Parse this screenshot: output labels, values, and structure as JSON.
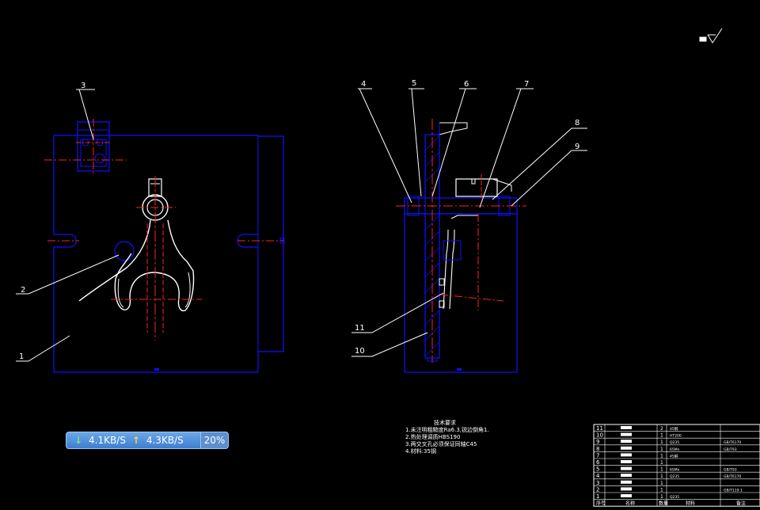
{
  "drawing": {
    "balloons": [
      "1",
      "2",
      "3",
      "4",
      "5",
      "6",
      "7",
      "8",
      "9",
      "10",
      "11"
    ],
    "tech_title": "技术要求",
    "tech_notes": [
      "1.未注明粗糙度Ra6.3,锐边倒角1.",
      "2.热处理调质HBS190",
      "3.两交叉孔必须保证同轴C45",
      "4.材料:35钢"
    ]
  },
  "net_widget": {
    "download": "4.1KB/S",
    "upload": "4.3KB/S",
    "percent": "20%"
  },
  "bom": {
    "rows": [
      {
        "no": "11",
        "qty": "2",
        "code": "45钢",
        "std": ""
      },
      {
        "no": "10",
        "qty": "1",
        "code": "HT200",
        "std": ""
      },
      {
        "no": "9",
        "qty": "1",
        "code": "Q235",
        "std": "GB/T6170"
      },
      {
        "no": "8",
        "qty": "1",
        "code": "65Mn",
        "std": "GB/T93"
      },
      {
        "no": "7",
        "qty": "1",
        "code": "45钢",
        "std": ""
      },
      {
        "no": "6",
        "qty": "1",
        "code": "",
        "std": ""
      },
      {
        "no": "5",
        "qty": "1",
        "code": "65Mn",
        "std": "GB/T93"
      },
      {
        "no": "4",
        "qty": "1",
        "code": "Q235",
        "std": "GB/T6170"
      },
      {
        "no": "3",
        "qty": "1",
        "code": "",
        "std": ""
      },
      {
        "no": "2",
        "qty": "1",
        "code": "",
        "std": "GB/T119.1"
      },
      {
        "no": "1",
        "qty": "1",
        "code": "Q235",
        "std": ""
      }
    ],
    "header": {
      "no": "序号",
      "name": "名称",
      "qty": "数量",
      "material": "材料",
      "remark": "备注"
    }
  },
  "colors": {
    "background": "#000000",
    "outline": "#0000ff",
    "center": "#ff0000",
    "leader": "#ffffff",
    "contour": "#ffffff"
  }
}
